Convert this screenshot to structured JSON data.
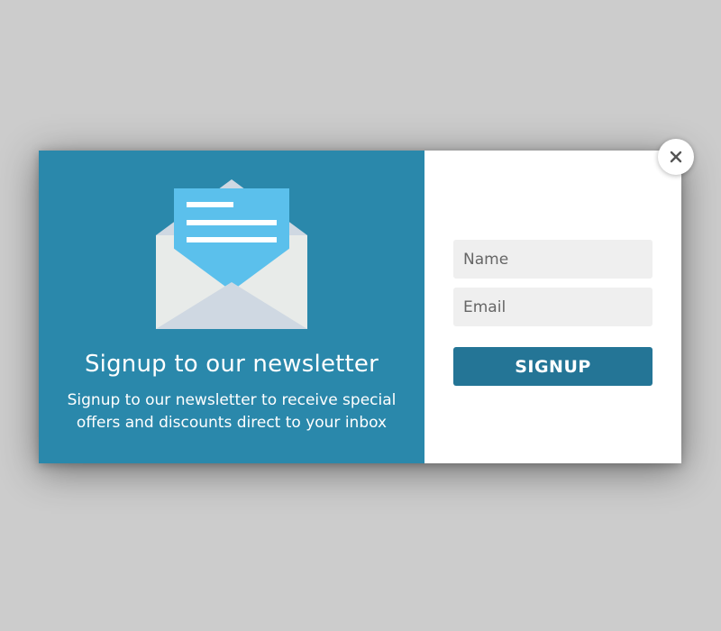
{
  "modal": {
    "headline": "Signup to our newsletter",
    "subtext": "Signup to our newsletter to receive special offers and discounts direct to your inbox",
    "form": {
      "name_placeholder": "Name",
      "email_placeholder": "Email",
      "submit_label": "SIGNUP"
    },
    "close_icon": "close-icon",
    "illustration_icon": "open-envelope-icon"
  },
  "colors": {
    "page_background": "#cccccc",
    "left_panel": "#2a88ab",
    "button": "#247596",
    "input_background": "#efefef",
    "letter": "#5bc0ec",
    "envelope": "#e8ebe9"
  }
}
